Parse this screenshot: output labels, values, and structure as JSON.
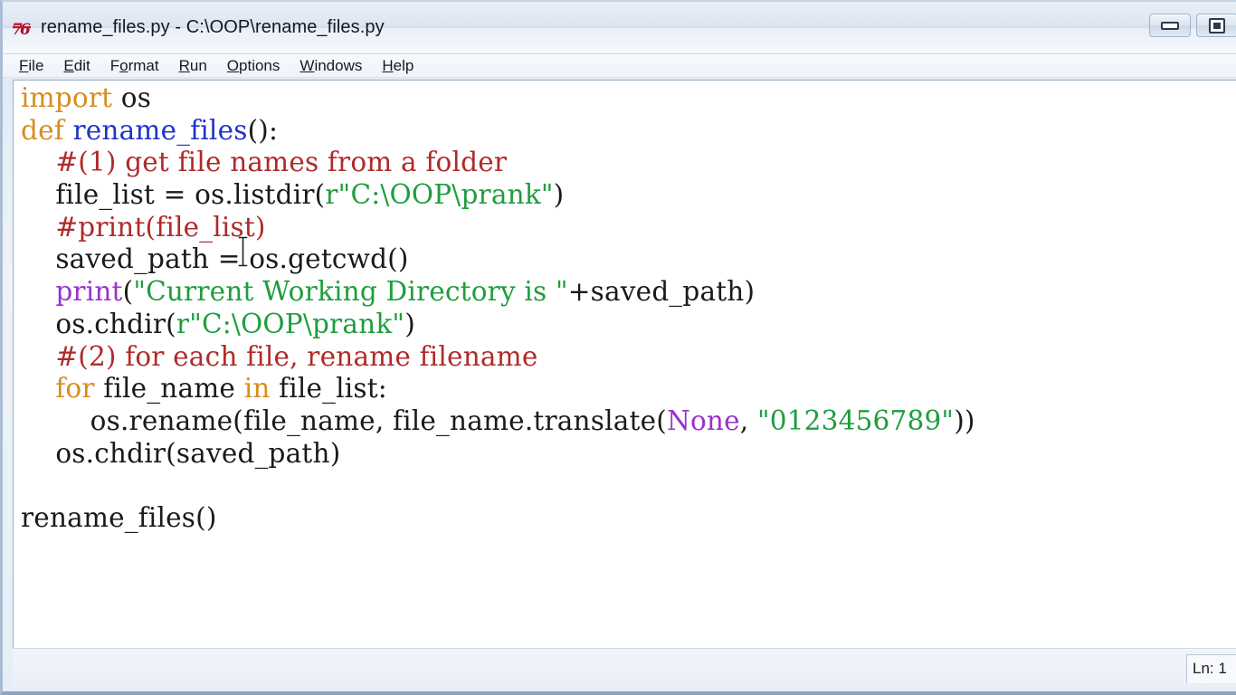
{
  "window": {
    "title": "rename_files.py - C:\\OOP\\rename_files.py",
    "icon": "python-idle-icon",
    "buttons": {
      "minimize": "minimize-button",
      "maximize": "maximize-button"
    }
  },
  "menubar": {
    "items": [
      {
        "label": "File",
        "accel": "F"
      },
      {
        "label": "Edit",
        "accel": "E"
      },
      {
        "label": "Format",
        "accel": "o"
      },
      {
        "label": "Run",
        "accel": "R"
      },
      {
        "label": "Options",
        "accel": "O"
      },
      {
        "label": "Windows",
        "accel": "W"
      },
      {
        "label": "Help",
        "accel": "H"
      }
    ]
  },
  "editor": {
    "language": "python",
    "code_lines": [
      "import os",
      "def rename_files():",
      "    #(1) get file names from a folder",
      "    file_list = os.listdir(r\"C:\\OOP\\prank\")",
      "    #print(file_list)",
      "    saved_path = os.getcwd()",
      "    print(\"Current Working Directory is \"+saved_path)",
      "    os.chdir(r\"C:\\OOP\\prank\")",
      "    #(2) for each file, rename filename",
      "    for file_name in file_list:",
      "        os.rename(file_name, file_name.translate(None, \"0123456789\"))",
      "    os.chdir(saved_path)",
      "",
      "rename_files()"
    ],
    "syntax_colors": {
      "keyword": "#d98c20",
      "definition": "#1f33cc",
      "comment": "#b02a2a",
      "string": "#1e9e3e",
      "builtin": "#9932cc",
      "plain": "#1a1a1a",
      "background": "#ffffff"
    }
  },
  "statusbar": {
    "position_label": "Ln: 1"
  }
}
